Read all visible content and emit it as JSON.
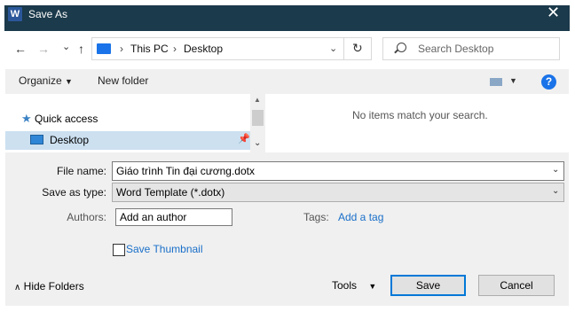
{
  "window": {
    "title": "Save As",
    "app_icon": "W"
  },
  "nav": {
    "back": "←",
    "forward": "→",
    "recent": "⌄",
    "up": "↑",
    "breadcrumb": [
      "This PC",
      "Desktop"
    ],
    "separator": "›",
    "dropdown": "⌄",
    "refresh": "↻",
    "search_placeholder": "Search Desktop"
  },
  "toolbar": {
    "organize": "Organize",
    "new_folder": "New folder",
    "help": "?"
  },
  "sidebar": {
    "quick_access": "Quick access",
    "desktop": "Desktop"
  },
  "content": {
    "empty_message": "No items match your search."
  },
  "form": {
    "file_name_label": "File name:",
    "file_name_value": "Giáo trình Tin đại cương.dotx",
    "save_type_label": "Save as type:",
    "save_type_value": "Word Template (*.dotx)",
    "authors_label": "Authors:",
    "authors_value": "Add an author",
    "tags_label": "Tags:",
    "tags_value": "Add a tag",
    "thumbnail_label": "Save Thumbnail"
  },
  "footer": {
    "hide_folders": "Hide Folders",
    "tools": "Tools",
    "save": "Save",
    "cancel": "Cancel"
  },
  "colors": {
    "titlebar": "#1b3a4b",
    "accent": "#1a73e8",
    "link": "#1a6fc9",
    "selected": "#cce0f0"
  }
}
